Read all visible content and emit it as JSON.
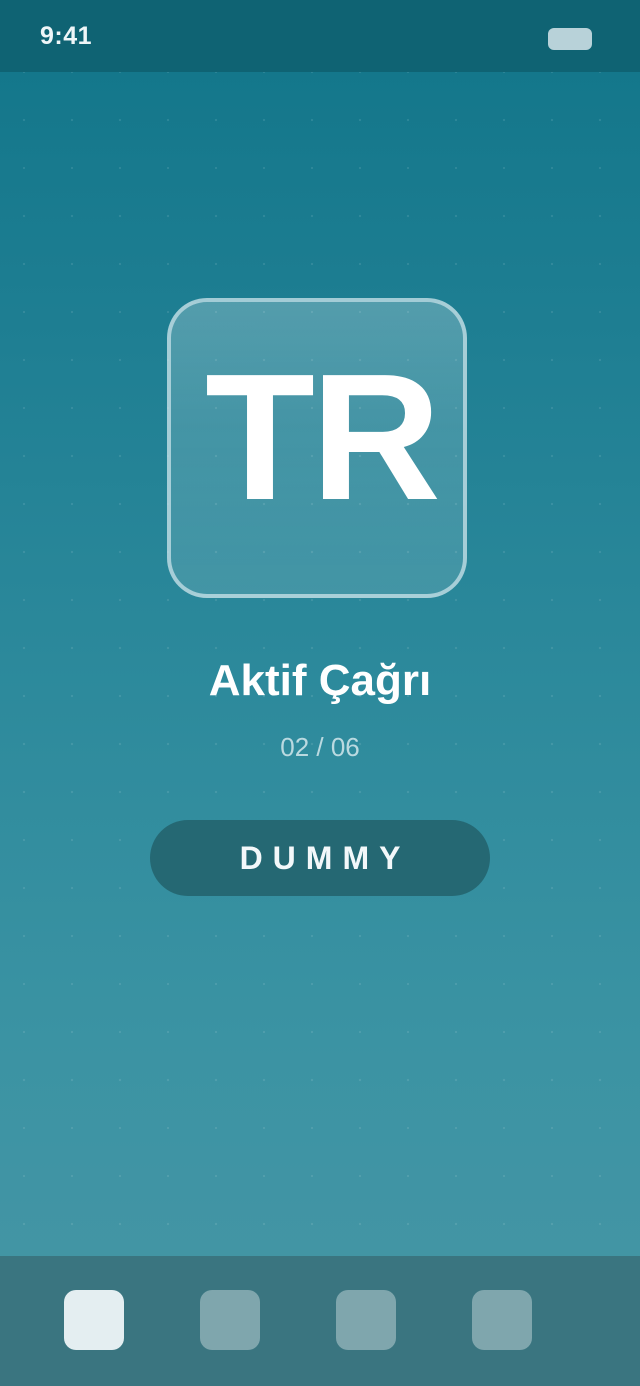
{
  "status_bar": {
    "time": "9:41",
    "battery_icon": "battery-icon"
  },
  "logo": {
    "text": "TR"
  },
  "main": {
    "title": "Aktif Çağrı",
    "counter": "02 / 06",
    "button_label": "DUMMY"
  },
  "tab_bar": {
    "active_index": 0,
    "tabs": [
      {
        "icon": "tab-icon-1"
      },
      {
        "icon": "tab-icon-2"
      },
      {
        "icon": "tab-icon-3"
      },
      {
        "icon": "tab-icon-4"
      }
    ]
  },
  "colors": {
    "status_bar": "#0f6373",
    "background_top": "#117589",
    "background_bottom": "#4796a5",
    "button": "#256873",
    "bottom_bar": "#3a7580",
    "tab_active": "#e4eef1",
    "tab_inactive": "#7fa6ad"
  }
}
